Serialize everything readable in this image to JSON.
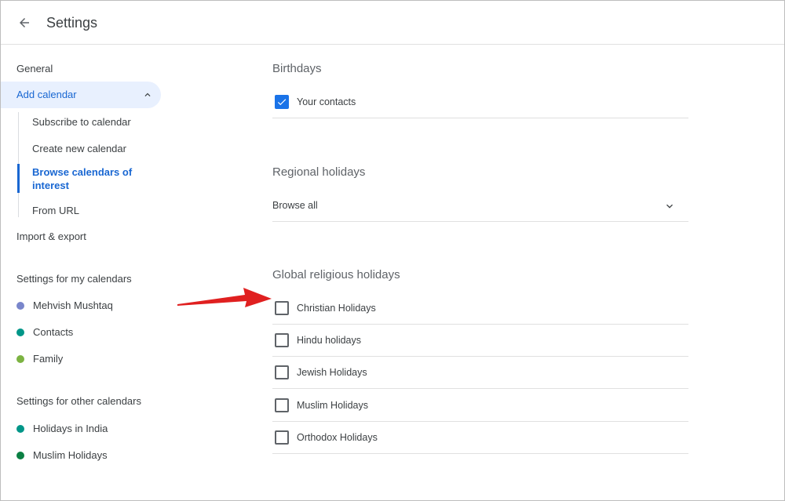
{
  "header": {
    "title": "Settings"
  },
  "sidebar": {
    "general": "General",
    "add_calendar": "Add calendar",
    "sub_items": [
      "Subscribe to calendar",
      "Create new calendar",
      "Browse calendars of interest",
      "From URL"
    ],
    "import_export": "Import & export",
    "my_calendars": {
      "title": "Settings for my calendars",
      "items": [
        {
          "label": "Mehvish Mushtaq",
          "color": "#7986cb"
        },
        {
          "label": "Contacts",
          "color": "#009688"
        },
        {
          "label": "Family",
          "color": "#7cb342"
        }
      ]
    },
    "other_calendars": {
      "title": "Settings for other calendars",
      "items": [
        {
          "label": "Holidays in India",
          "color": "#009688"
        },
        {
          "label": "Muslim Holidays",
          "color": "#0b8043"
        }
      ]
    }
  },
  "main": {
    "birthdays": {
      "title": "Birthdays",
      "item": "Your contacts",
      "checked": true
    },
    "regional": {
      "title": "Regional holidays",
      "select_value": "Browse all"
    },
    "religious": {
      "title": "Global religious holidays",
      "items": [
        {
          "label": "Christian Holidays",
          "checked": false
        },
        {
          "label": "Hindu holidays",
          "checked": false
        },
        {
          "label": "Jewish Holidays",
          "checked": false
        },
        {
          "label": "Muslim Holidays",
          "checked": false
        },
        {
          "label": "Orthodox Holidays",
          "checked": false
        }
      ]
    }
  },
  "colors": {
    "accent": "#1967d2",
    "checkbox": "#1a73e8",
    "active_bg": "#e8f0fe",
    "annotation_arrow": "#e02020"
  },
  "icons": {
    "back": "arrow-back-icon",
    "collapse": "chevron-up-icon",
    "dropdown": "chevron-down-icon",
    "annotation": "red-arrow-icon"
  }
}
